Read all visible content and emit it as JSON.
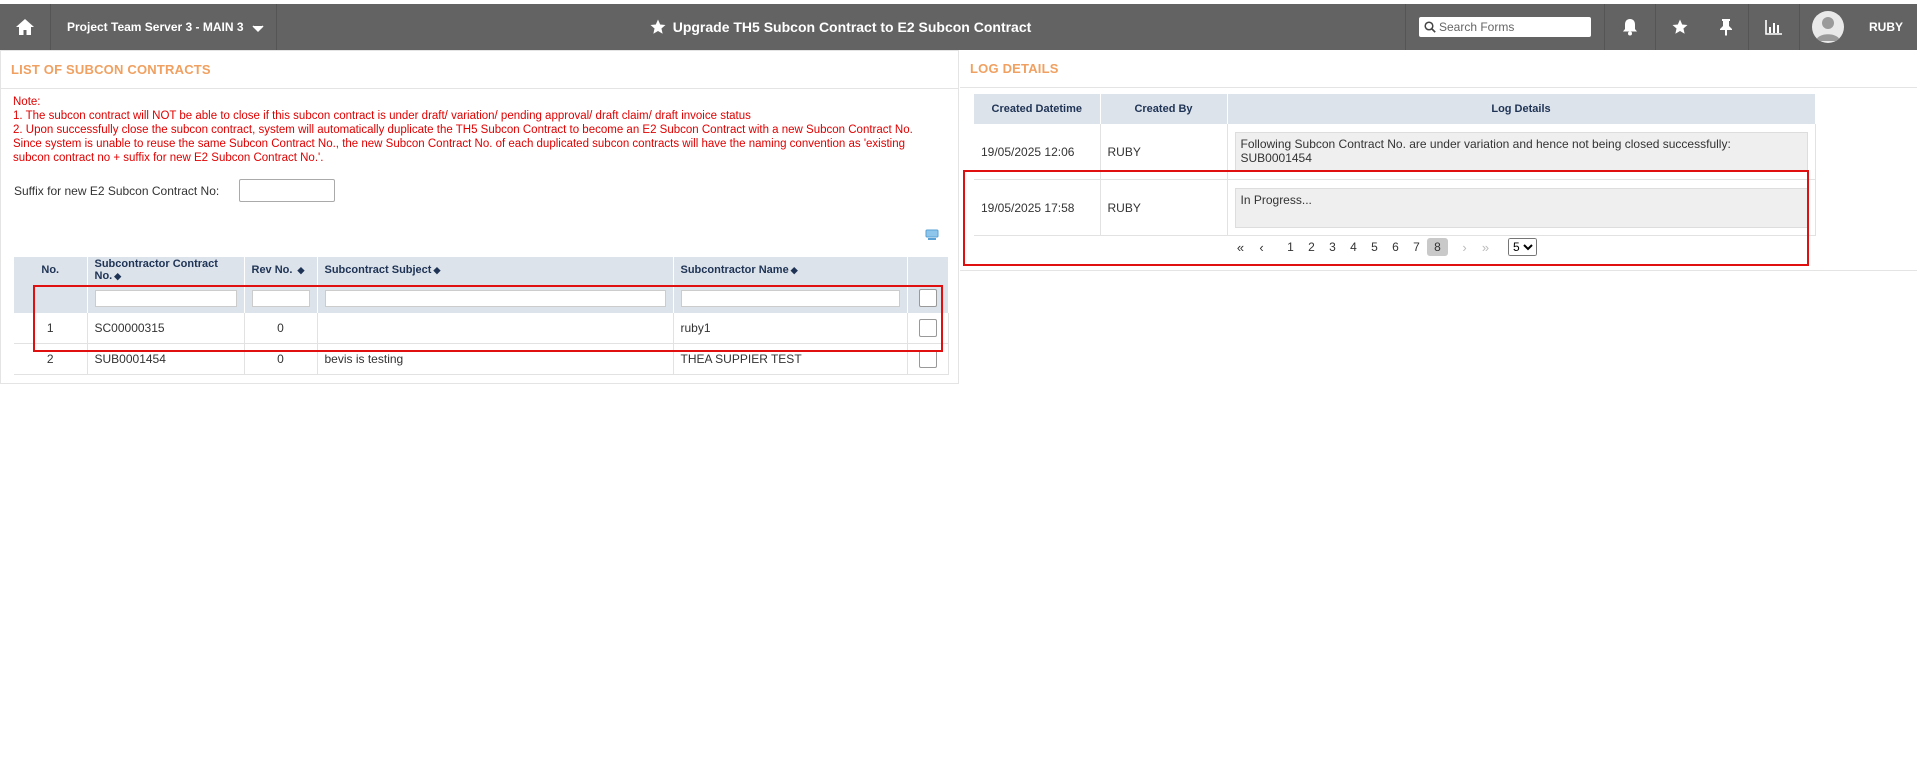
{
  "topbar": {
    "project": "Project Team Server 3 - MAIN 3",
    "title": "Upgrade TH5 Subcon Contract to E2 Subcon Contract",
    "search_placeholder": "Search Forms",
    "user": "RUBY",
    "icons": [
      "home-icon",
      "chevron-down-icon",
      "star-icon",
      "search-icon",
      "bell-icon",
      "star-icon",
      "pin-icon",
      "chart-icon",
      "avatar"
    ]
  },
  "left_panel": {
    "header": "LIST OF SUBCON CONTRACTS",
    "note_title": "Note:",
    "note_1": "1. The subcon contract will NOT be able to close if this subcon contract is under draft/ variation/ pending approval/ draft claim/ draft invoice status",
    "note_2": "2. Upon successfully close the subcon contract, system will automatically duplicate the TH5 Subcon Contract to become an E2 Subcon Contract with a new Subcon Contract No. Since system is unable to reuse the same Subcon Contract No., the new Subcon Contract No. of each duplicated subcon contracts will have the naming convention as 'existing subcon contract no + suffix for new E2 Subcon Contract No.'.",
    "suffix_label": "Suffix for new E2 Subcon Contract No:",
    "table": {
      "columns": [
        "No.",
        "Subcontractor Contract No.",
        "Rev No.",
        "Subcontract Subject",
        "Subcontractor Name"
      ],
      "rows": [
        {
          "no": "1",
          "contract_no": "SC00000315",
          "rev": "0",
          "subject": "",
          "name": "ruby1"
        },
        {
          "no": "2",
          "contract_no": "SUB0001454",
          "rev": "0",
          "subject": "bevis is testing",
          "name": "THEA SUPPIER TEST"
        }
      ]
    }
  },
  "right_panel": {
    "header": "LOG DETAILS",
    "table": {
      "columns": [
        "Created Datetime",
        "Created By",
        "Log Details"
      ],
      "rows": [
        {
          "datetime": "19/05/2025 12:06",
          "by": "RUBY",
          "details": "Following Subcon Contract No. are under variation and hence not being closed successfully: SUB0001454"
        },
        {
          "datetime": "19/05/2025 17:58",
          "by": "RUBY",
          "details": "In Progress..."
        }
      ]
    },
    "pagination": {
      "pages": [
        "1",
        "2",
        "3",
        "4",
        "5",
        "6",
        "7",
        "8"
      ],
      "current": "8",
      "page_size": "5"
    }
  },
  "colors": {
    "topbar": "#636363",
    "header_orange": "#f0a060",
    "note_red": "#e00000",
    "table_header": "#dde3ea",
    "highlight": "#e01010"
  }
}
